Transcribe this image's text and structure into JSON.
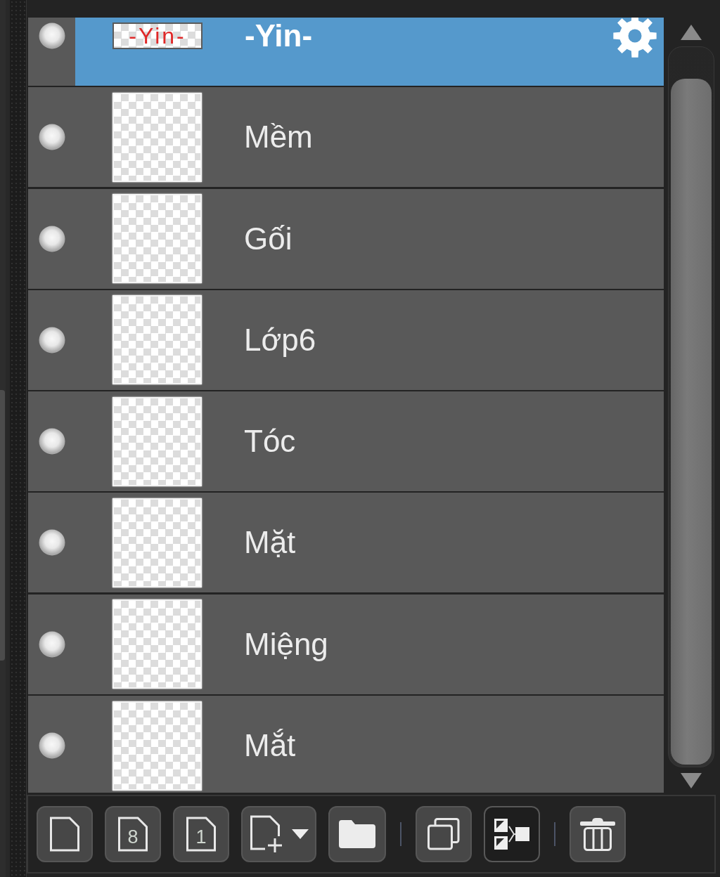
{
  "layers": [
    {
      "name": "-Yin-",
      "kind": "text",
      "thumbnail_text": "-Yin-",
      "visible": true,
      "selected": true
    },
    {
      "name": "Mềm",
      "kind": "raster",
      "visible": true,
      "selected": false
    },
    {
      "name": "Gối",
      "kind": "raster",
      "visible": true,
      "selected": false
    },
    {
      "name": "Lớp6",
      "kind": "raster",
      "visible": true,
      "selected": false
    },
    {
      "name": "Tóc",
      "kind": "raster",
      "visible": true,
      "selected": false
    },
    {
      "name": "Mặt",
      "kind": "raster",
      "visible": true,
      "selected": false
    },
    {
      "name": "Miệng",
      "kind": "raster",
      "visible": true,
      "selected": false
    },
    {
      "name": "Mắt",
      "kind": "raster",
      "visible": true,
      "selected": false
    }
  ],
  "toolbar": {
    "groups": [
      [
        {
          "kind": "new-layer",
          "pressed": false
        },
        {
          "kind": "new-digit-layer",
          "glyph": "8",
          "pressed": false
        },
        {
          "kind": "new-digit-layer",
          "glyph": "1",
          "pressed": false
        },
        {
          "kind": "add-menu",
          "pressed": false
        },
        {
          "kind": "folder",
          "pressed": false
        }
      ],
      [
        {
          "kind": "duplicate",
          "pressed": false
        },
        {
          "kind": "merge",
          "pressed": true
        }
      ],
      [
        {
          "kind": "delete",
          "pressed": false
        }
      ]
    ]
  }
}
